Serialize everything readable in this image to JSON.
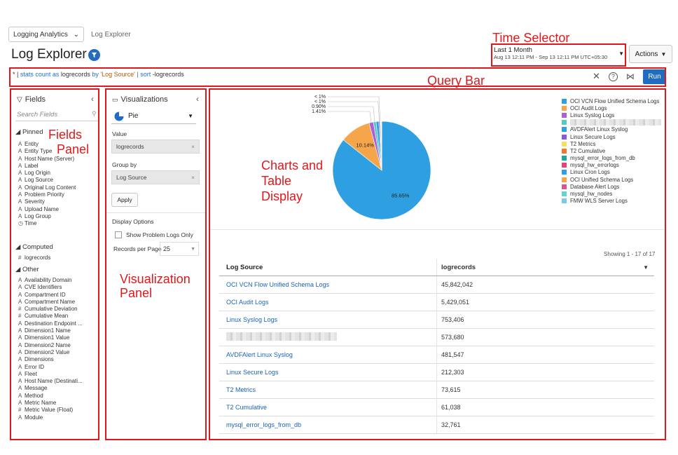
{
  "header": {
    "app_switcher": "Logging Analytics",
    "breadcrumb": "Log Explorer",
    "title": "Log Explorer",
    "time_range": "Last 1 Month",
    "time_detail": "Aug 13 12:11 PM - Sep 13 12:11 PM UTC+05:30",
    "actions_label": "Actions"
  },
  "query": {
    "p1": "* | ",
    "p2": "stats count as ",
    "p3": "logrecords",
    "p4": " by ",
    "p5": "'Log Source'",
    "p6": " | sort ",
    "p7": "-logrecords",
    "run_label": "Run"
  },
  "annotations": {
    "time_selector": "Time Selector",
    "query_bar": "Query Bar",
    "fields_panel_1": "Fields",
    "fields_panel_2": "Panel",
    "charts_1": "Charts and",
    "charts_2": "Table",
    "charts_3": "Display",
    "viz_panel_1": "Visualization",
    "viz_panel_2": "Panel"
  },
  "fields_panel": {
    "title": "Fields",
    "search_placeholder": "Search Fields",
    "pinned_label": "Pinned",
    "pinned": [
      {
        "t": "A",
        "n": "Entity"
      },
      {
        "t": "A",
        "n": "Entity Type"
      },
      {
        "t": "A",
        "n": "Host Name (Server)"
      },
      {
        "t": "A",
        "n": "Label"
      },
      {
        "t": "A",
        "n": "Log Origin"
      },
      {
        "t": "A",
        "n": "Log Source"
      },
      {
        "t": "A",
        "n": "Original Log Content"
      },
      {
        "t": "A",
        "n": "Problem Priority"
      },
      {
        "t": "A",
        "n": "Severity"
      },
      {
        "t": "A",
        "n": "Upload Name"
      },
      {
        "t": "A",
        "n": "Log Group"
      },
      {
        "t": "◷",
        "n": "Time"
      }
    ],
    "computed_label": "Computed",
    "computed": [
      {
        "t": "#",
        "n": "logrecords"
      }
    ],
    "other_label": "Other",
    "other": [
      {
        "t": "A",
        "n": "Availability Domain"
      },
      {
        "t": "A",
        "n": "CVE Identifiers"
      },
      {
        "t": "A",
        "n": "Compartment ID"
      },
      {
        "t": "A",
        "n": "Compartment Name"
      },
      {
        "t": "#",
        "n": "Cumulative Deviation"
      },
      {
        "t": "#",
        "n": "Cumulative Mean"
      },
      {
        "t": "A",
        "n": "Destination Endpoint ..."
      },
      {
        "t": "A",
        "n": "Dimension1 Name"
      },
      {
        "t": "A",
        "n": "Dimension1 Value"
      },
      {
        "t": "A",
        "n": "Dimension2 Name"
      },
      {
        "t": "A",
        "n": "Dimension2 Value"
      },
      {
        "t": "A",
        "n": "Dimensions"
      },
      {
        "t": "A",
        "n": "Error ID"
      },
      {
        "t": "A",
        "n": "Fleet"
      },
      {
        "t": "A",
        "n": "Host Name (Destinati..."
      },
      {
        "t": "A",
        "n": "Message"
      },
      {
        "t": "A",
        "n": "Method"
      },
      {
        "t": "A",
        "n": "Metric Name"
      },
      {
        "t": "#",
        "n": "Metric Value (Float)"
      },
      {
        "t": "A",
        "n": "Module"
      }
    ]
  },
  "viz_panel": {
    "title": "Visualizations",
    "chart_type": "Pie",
    "value_label": "Value",
    "value": "logrecords",
    "group_by_label": "Group by",
    "group_by": "Log Source",
    "apply_label": "Apply",
    "display_options_label": "Display Options",
    "show_problem_logs": "Show Problem Logs Only",
    "records_per_page_label": "Records per Page",
    "records_per_page": "25"
  },
  "colors": {
    "accent": "#1f6cc1",
    "annotation_red": "#e0181b"
  },
  "chart_data": {
    "type": "pie",
    "series": [
      {
        "name": "OCI VCN Flow Unified Schema Logs",
        "value": 85.65,
        "color": "#2e9fe0"
      },
      {
        "name": "OCI Audit Logs",
        "value": 10.14,
        "color": "#f5a64a"
      },
      {
        "name": "Linux Syslog Logs",
        "value": 1.41,
        "color": "#ad5fd6"
      },
      {
        "name": "",
        "value": 0.9,
        "color": "#55c9c9"
      },
      {
        "name": "AVDFAlert Linux Syslog",
        "value": 0.9,
        "color": "#2e9fe0"
      },
      {
        "name": "Linux Secure Logs",
        "value": 0.4,
        "color": "#8a5ad2"
      },
      {
        "name": "T2 Metrics",
        "value": 0.14,
        "color": "#f7df5a"
      },
      {
        "name": "T2 Cumulative",
        "value": 0.11,
        "color": "#ec7a2c"
      },
      {
        "name": "mysql_error_logs_from_db",
        "value": 0.06,
        "color": "#20a5a5"
      },
      {
        "name": "mysql_hw_errorlogs",
        "value": 0.05,
        "color": "#e0457a"
      },
      {
        "name": "Linux Cron Logs",
        "value": 0.05,
        "color": "#2e9fe0"
      },
      {
        "name": "OCI Unified Schema Logs",
        "value": 0.04,
        "color": "#f5a64a"
      },
      {
        "name": "Database Alert Logs",
        "value": 0.04,
        "color": "#d9558d"
      },
      {
        "name": "mysql_hw_nodes",
        "value": 0.03,
        "color": "#66d3cf"
      },
      {
        "name": "FMW WLS Server Logs",
        "value": 0.03,
        "color": "#7bc8ec"
      }
    ],
    "data_labels": [
      {
        "text": "85.65%"
      },
      {
        "text": "10.14%"
      },
      {
        "text": "1.41%"
      },
      {
        "text": "0.90%"
      },
      {
        "text": "< 1%"
      },
      {
        "text": "< 1%"
      }
    ]
  },
  "table": {
    "showing": "Showing 1 - 17 of 17",
    "headers": [
      "Log Source",
      "logrecords"
    ],
    "rows": [
      {
        "source": "OCI VCN Flow Unified Schema Logs",
        "count": "45,842,042"
      },
      {
        "source": "OCI Audit Logs",
        "count": "5,429,051"
      },
      {
        "source": "Linux Syslog Logs",
        "count": "753,406"
      },
      {
        "source": "",
        "count": "573,680"
      },
      {
        "source": "AVDFAlert Linux Syslog",
        "count": "481,547"
      },
      {
        "source": "Linux Secure Logs",
        "count": "212,303"
      },
      {
        "source": "T2 Metrics",
        "count": "73,615"
      },
      {
        "source": "T2 Cumulative",
        "count": "61,038"
      },
      {
        "source": "mysql_error_logs_from_db",
        "count": "32,761"
      }
    ]
  }
}
